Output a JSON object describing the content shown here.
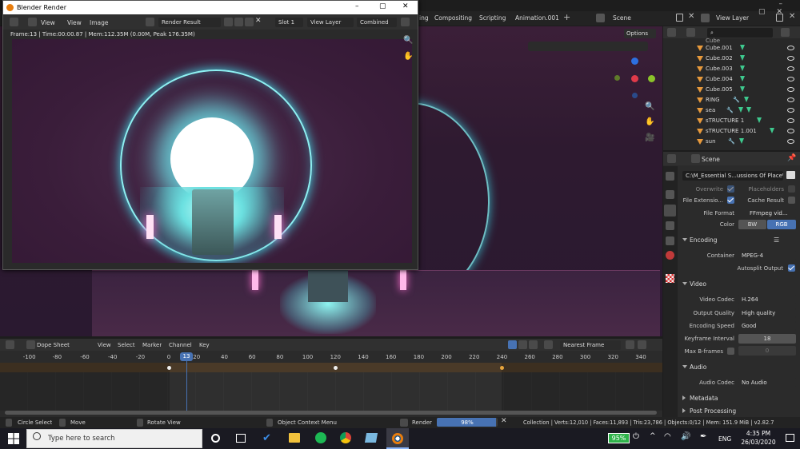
{
  "topbar": {
    "tabs": [
      "ing",
      "Compositing",
      "Scripting",
      "Animation.001"
    ],
    "add": "+",
    "scene": "Scene",
    "view_layer": "View Layer"
  },
  "render_window": {
    "title": "Blender Render",
    "menus": [
      "View",
      "View",
      "Image"
    ],
    "image_name": "Render Result",
    "slot": "Slot 1",
    "layer": "View Layer",
    "pass": "Combined",
    "status": "Frame:13 | Time:00:00.87 | Mem:112.35M (0.00M, Peak 176.35M)"
  },
  "viewport": {
    "options": "Options"
  },
  "outliner": {
    "items": [
      {
        "name": "Cube.001"
      },
      {
        "name": "Cube.002"
      },
      {
        "name": "Cube.003"
      },
      {
        "name": "Cube.004"
      },
      {
        "name": "Cube.005"
      },
      {
        "name": "RING"
      },
      {
        "name": "sea"
      },
      {
        "name": "sTRUCTURE 1"
      },
      {
        "name": "sTRUCTURE 1.001"
      },
      {
        "name": "sun"
      }
    ],
    "top_cut": "Cube"
  },
  "properties": {
    "header": "Scene",
    "path": "C:\\M_Essential S...ussions Of Place\\",
    "overwrite": "Overwrite",
    "placeholders": "Placeholders",
    "file_ext": "File Extensio...",
    "cache_result": "Cache Result",
    "file_format_label": "File Format",
    "file_format": "FFmpeg vid...",
    "color_label": "Color",
    "bw": "BW",
    "rgb": "RGB",
    "encoding": "Encoding",
    "container_label": "Container",
    "container": "MPEG-4",
    "autosplit": "Autosplit Output",
    "video": "Video",
    "video_codec_label": "Video Codec",
    "video_codec": "H.264",
    "quality_label": "Output Quality",
    "quality": "High quality",
    "speed_label": "Encoding Speed",
    "speed": "Good",
    "keyframe_label": "Keyframe Interval",
    "keyframe": "18",
    "bframes_label": "Max B-frames",
    "bframes": "0",
    "audio": "Audio",
    "audio_codec_label": "Audio Codec",
    "audio_codec": "No Audio",
    "metadata": "Metadata",
    "post": "Post Processing"
  },
  "dopesheet": {
    "mode": "Dope Sheet",
    "menus": [
      "View",
      "Select",
      "Marker",
      "Channel",
      "Key"
    ],
    "snap": "Nearest Frame",
    "current_frame": "13",
    "ticks": [
      "-100",
      "-80",
      "-60",
      "-40",
      "-20",
      "0",
      "20",
      "40",
      "60",
      "80",
      "100",
      "120",
      "140",
      "160",
      "180",
      "200",
      "220",
      "240",
      "260",
      "280",
      "300",
      "320",
      "340"
    ],
    "keyframes": [
      0,
      120,
      240
    ]
  },
  "statusbar": {
    "circle_select": "Circle Select",
    "move": "Move",
    "rotate": "Rotate View",
    "context": "Object Context Menu",
    "render": "Render",
    "render_pct": "98%",
    "render_fill": 0.98,
    "stats": "Collection | Verts:12,010 | Faces:11,893 | Tris:23,786 | Objects:0/12 | Mem: 151.9 MiB | v2.82.7"
  },
  "taskbar": {
    "search": "Type here to search",
    "battery": "95%",
    "lang": "ENG",
    "time": "4:35 PM",
    "date": "26/03/2020"
  },
  "colors": {
    "accent": "#4772b3",
    "orange": "#e89a3c",
    "green": "#3ec98e"
  }
}
